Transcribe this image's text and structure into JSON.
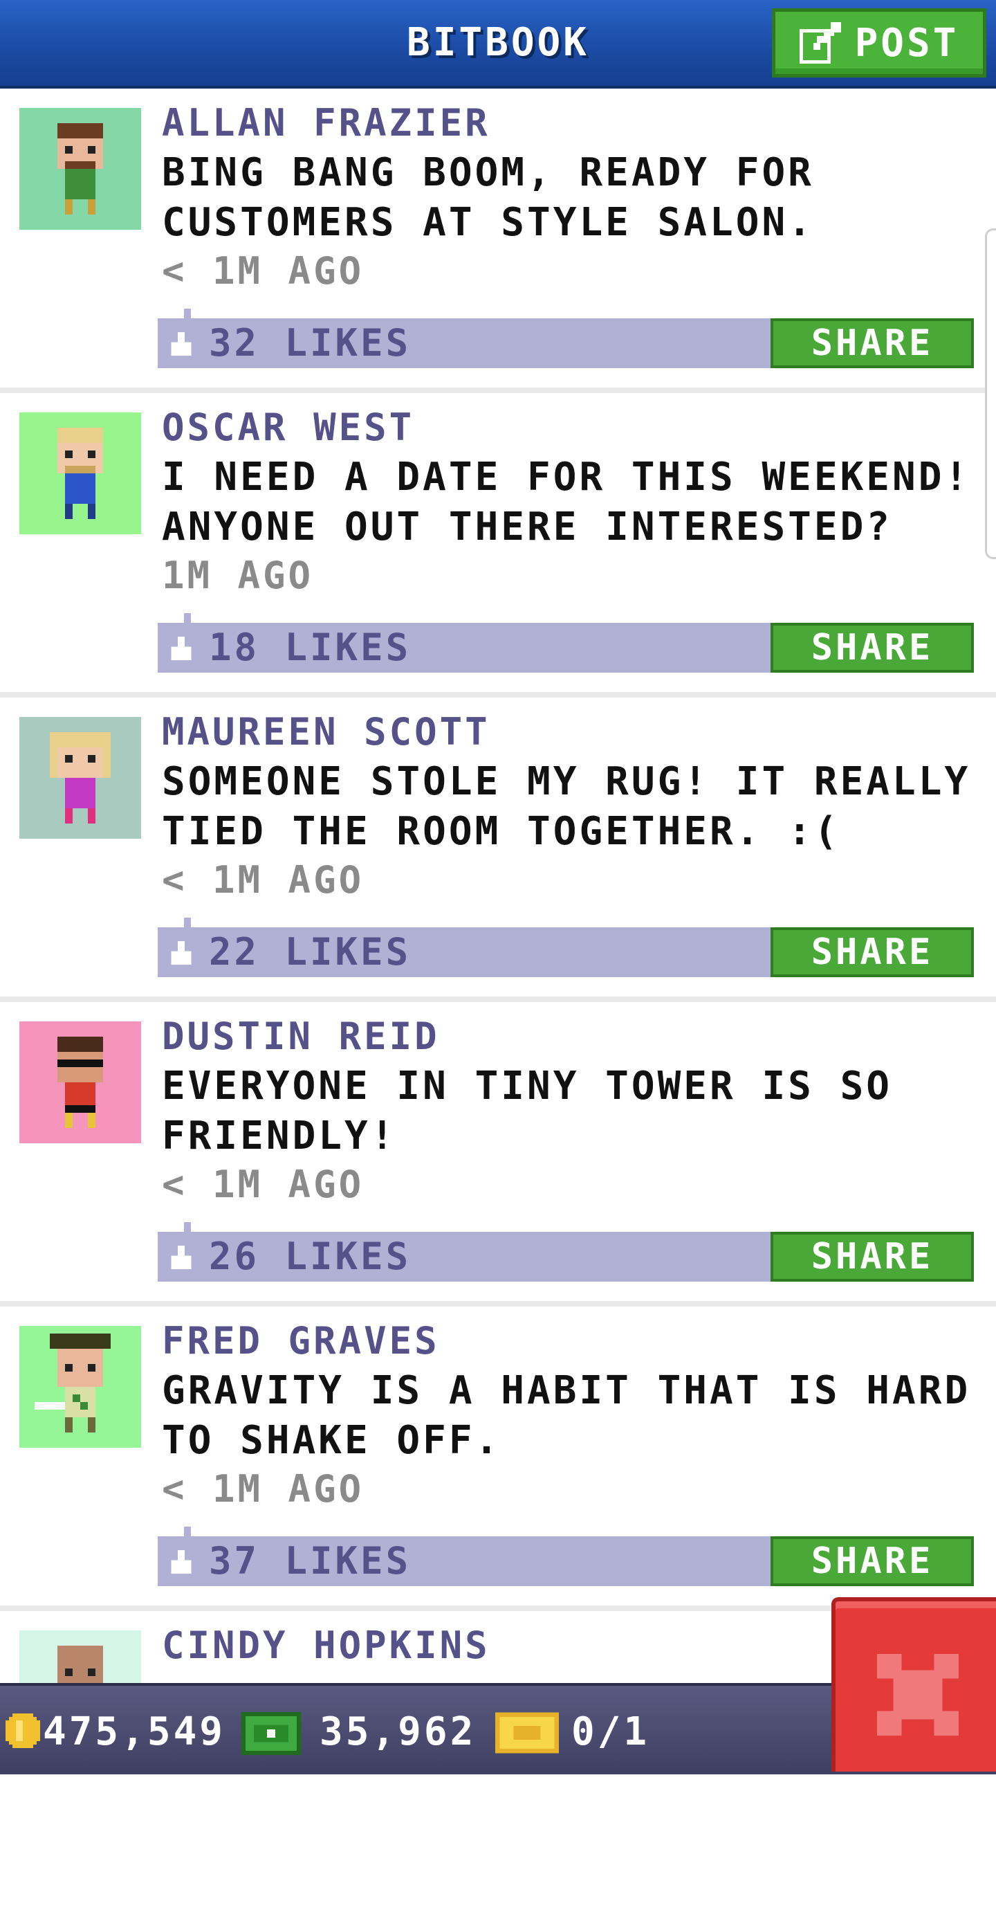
{
  "header": {
    "title": "BITBOOK",
    "post_label": "POST"
  },
  "posts": [
    {
      "author": "ALLAN FRAZIER",
      "message": "BING BANG BOOM, READY FOR CUSTOMERS AT STYLE SALON.",
      "time": "< 1M AGO",
      "likes": "32 LIKES",
      "share_label": "SHARE",
      "avatar_bg": "#86d7a8"
    },
    {
      "author": "OSCAR WEST",
      "message": "I NEED A DATE FOR THIS WEEKEND! ANYONE OUT THERE INTERESTED?",
      "time": "1M AGO",
      "likes": "18 LIKES",
      "share_label": "SHARE",
      "avatar_bg": "#98f58e"
    },
    {
      "author": "MAUREEN SCOTT",
      "message": "SOMEONE STOLE MY RUG! IT REALLY TIED THE ROOM TOGETHER. :(",
      "time": "< 1M AGO",
      "likes": "22 LIKES",
      "share_label": "SHARE",
      "avatar_bg": "#a9cbbf"
    },
    {
      "author": "DUSTIN REID",
      "message": "EVERYONE IN TINY TOWER IS SO FRIENDLY!",
      "time": "< 1M AGO",
      "likes": "26 LIKES",
      "share_label": "SHARE",
      "avatar_bg": "#f595bb"
    },
    {
      "author": "FRED GRAVES",
      "message": "GRAVITY IS A HABIT THAT IS HARD TO SHAKE OFF.",
      "time": "< 1M AGO",
      "likes": "37 LIKES",
      "share_label": "SHARE",
      "avatar_bg": "#95f597"
    },
    {
      "author": "CINDY HOPKINS",
      "message": "",
      "avatar_bg": "#d5f5e8"
    }
  ],
  "status": {
    "coins": "475,549",
    "bux": "35,962",
    "tickets": "0/1"
  },
  "colors": {
    "header_blue": "#1a4aa3",
    "share_green": "#49a838",
    "likes_bar": "#b1b1d6",
    "author_purple": "#55528a",
    "close_red": "#e53a3a"
  }
}
